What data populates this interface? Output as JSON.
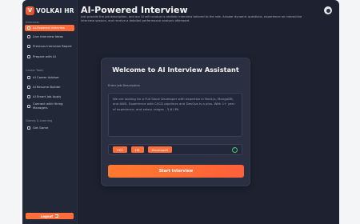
{
  "app": {
    "logo_mark": "V",
    "logo_text": "VOLKAI HR"
  },
  "sidebar": {
    "section_interview": "Interview",
    "interview_items": [
      {
        "label": "AI-Powered Interview",
        "icon": "robot-icon",
        "active": true
      },
      {
        "label": "Live Interview Ideas",
        "icon": "bulb-icon"
      },
      {
        "label": "Previous Interview Report",
        "icon": "report-icon"
      },
      {
        "label": "Prepare with AI",
        "icon": "sparkle-icon"
      }
    ],
    "section_career": "Career Tools",
    "career_items": [
      {
        "label": "AI Career Adviser",
        "icon": "compass-icon"
      },
      {
        "label": "AI Resume Builder",
        "icon": "document-icon"
      },
      {
        "label": "AI Smart Job Apply",
        "icon": "briefcase-icon"
      },
      {
        "label": "Connect with Hiring Managers",
        "icon": "people-icon"
      }
    ],
    "section_games": "Games & Learning",
    "games_items": [
      {
        "label": "Get Game",
        "icon": "gamepad-icon"
      }
    ],
    "logout_label": "Logout"
  },
  "header": {
    "title": "AI-Powered Interview",
    "description": "Just provide the job description, and our AI will conduct a realistic interview tailored to the role. Answer dynamic questions, experience an interactive interview session, and receive a detailed performance analysis afterward."
  },
  "card": {
    "title": "Welcome to AI Interview Assistant",
    "jd_label": "Enter Job Description",
    "jd_text": "We are looking for a Full Stack Developer with expertise in Next.js, MongoDB, and AWS. Experience with CI/CD pipelines and DevOps is a plus. With 1+ year of experience, and salary ranges - 3-6 LPA",
    "skills": [
      "CEO",
      "HR",
      "DevelopeR"
    ],
    "start_label": "Start Interview"
  },
  "colors": {
    "accent": "#ff6e3a",
    "panel": "#1e2230",
    "success": "#49c16a"
  }
}
